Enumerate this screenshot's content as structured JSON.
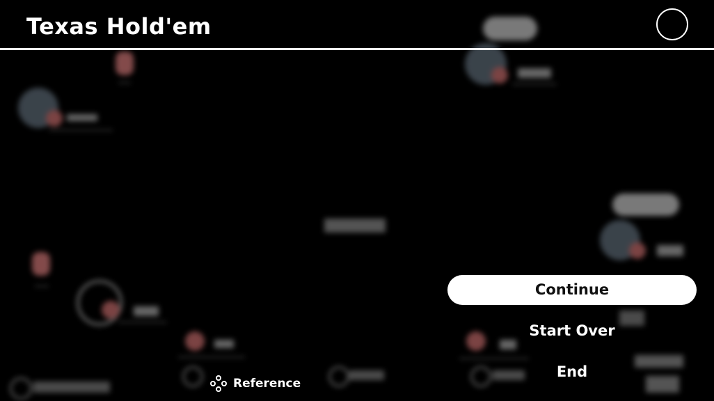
{
  "header": {
    "title": "Texas Hold'em"
  },
  "menu": {
    "items": [
      {
        "label": "Continue",
        "selected": true
      },
      {
        "label": "Start Over",
        "selected": false
      },
      {
        "label": "End",
        "selected": false
      }
    ]
  },
  "footer": {
    "reference_label": "Reference",
    "reference_icon": "button-cluster-icon"
  },
  "colors": {
    "background": "#000000",
    "foreground": "#ffffff",
    "selected_text": "#111111"
  }
}
